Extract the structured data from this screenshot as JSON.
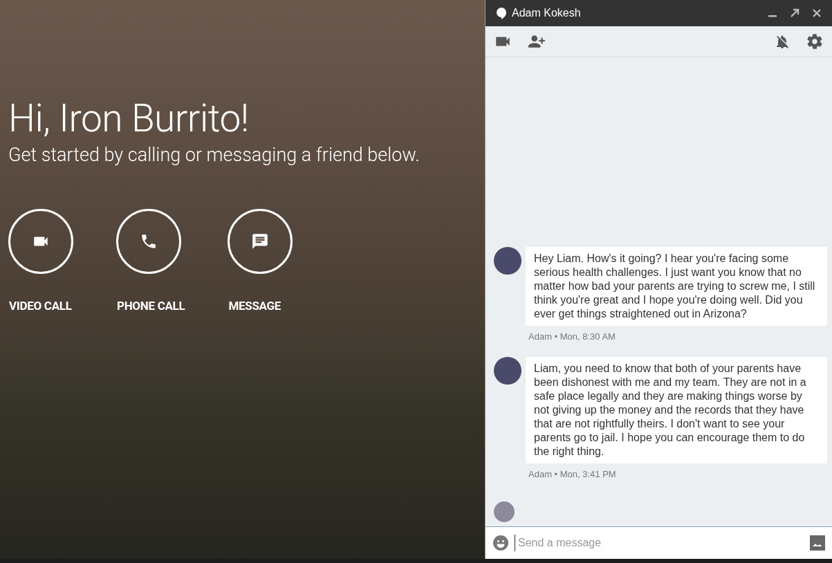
{
  "greeting": {
    "title": "Hi, Iron Burrito!",
    "subtitle": "Get started by calling or messaging a friend below."
  },
  "actions": [
    {
      "kind": "video",
      "label": "VIDEO CALL"
    },
    {
      "kind": "phone",
      "label": "PHONE CALL"
    },
    {
      "kind": "message",
      "label": "MESSAGE"
    }
  ],
  "chat": {
    "title": "Adam Kokesh",
    "messages": [
      {
        "text": "Hey Liam. How's it going? I hear you're facing some serious health challenges. I just want you know that no matter how bad your parents are trying to screw me, I still think you're great and I hope you're doing well. Did you ever get things straightened out in Arizona?",
        "meta": "Adam • Mon, 8:30 AM"
      },
      {
        "text": "Liam, you need to know that both of your parents have been dishonest with me and my team. They are not in a safe place legally and they are making things worse by not giving up the money and the records that they have that are not rightfully theirs. I don't want to see your parents go to jail. I hope you can encourage them to do the right thing.",
        "meta": "Adam • Mon, 3:41 PM"
      }
    ],
    "input": {
      "placeholder": "Send a message"
    }
  }
}
